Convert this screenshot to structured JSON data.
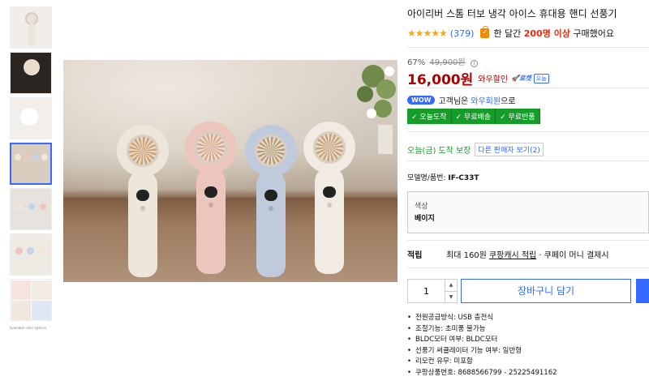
{
  "product": {
    "title": "아이리버 스톰 터보 냉각 아이스 휴대용 핸디 선풍기",
    "rating_stars": "★★★★★",
    "review_count": "(379)",
    "recent_buyers_prefix": "한 달간",
    "recent_buyers_count": "200명 이상",
    "recent_buyers_suffix": "구매했어요"
  },
  "pricing": {
    "discount_rate": "67%",
    "original_price": "49,900원",
    "info_icon": "i",
    "sale_price": "16,000원",
    "wow_discount_label": "와우할인",
    "rocket_label": "🚀로켓",
    "today_label": "오늘"
  },
  "wow": {
    "pill": "WOW",
    "text_prefix": "고객님은",
    "link": "와우회원",
    "text_suffix": "으로"
  },
  "badges": [
    "✓ 오늘도착",
    "✓ 무료배송",
    "✓ 무료반품"
  ],
  "delivery": {
    "date": "오늘(금)",
    "text": "도착 보장",
    "other_sellers": "다른 판매자 보기(2)"
  },
  "model": {
    "label": "모델명/품번:",
    "value": "IF-C33T"
  },
  "option": {
    "label": "색상",
    "value": "베이지"
  },
  "points": {
    "label": "적립",
    "prefix": "최대 160원",
    "link": "쿠팡캐시 적립",
    "suffix": "· 쿠페이 머니 결제시"
  },
  "purchase": {
    "quantity": "1",
    "up_arrow": "▲",
    "down_arrow": "▼",
    "cart_label": "장바구니 담기"
  },
  "specs": [
    "전원공급방식: USB 충전식",
    "조절기능: 초미풍 불가능",
    "BLDC모터 여부: BLDC모터",
    "선풍기 써큘레이터 기능 여부: 일반형",
    "리모컨 유무: 미포함",
    "쿠팡상품번호: 8688566799 - 25225491162"
  ],
  "thumbnail_caption": "Available color options",
  "colors": {
    "accent": "#346aff",
    "price_red": "#ae0000",
    "badge_green": "#169c29",
    "star": "#f5a623"
  }
}
